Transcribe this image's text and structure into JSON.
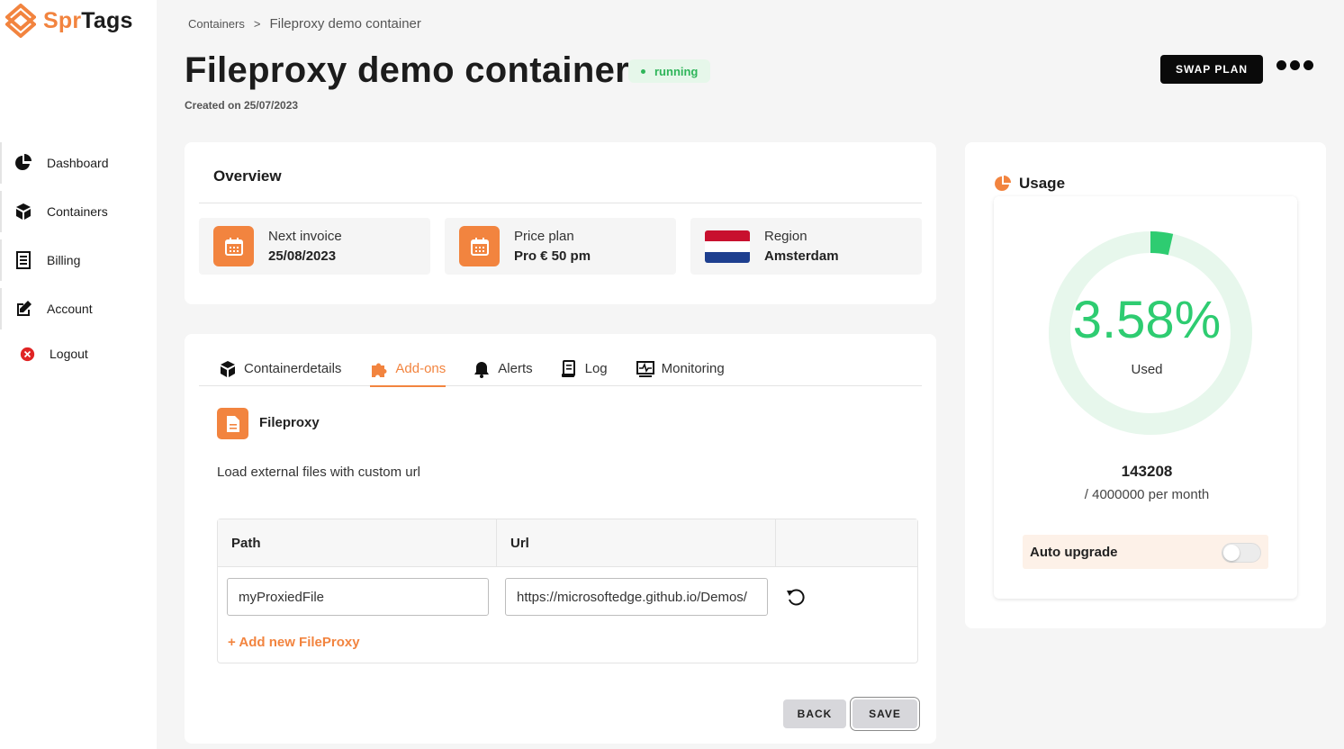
{
  "app": {
    "logo_part1": "Spr",
    "logo_part2": "Tags"
  },
  "sidebar": {
    "items": [
      {
        "label": "Dashboard",
        "icon": "pie-chart-icon"
      },
      {
        "label": "Containers",
        "icon": "box-icon"
      },
      {
        "label": "Billing",
        "icon": "receipt-icon"
      },
      {
        "label": "Account",
        "icon": "edit-icon"
      },
      {
        "label": "Logout",
        "icon": "close-circle-icon"
      }
    ]
  },
  "breadcrumb": {
    "parent": "Containers",
    "separator": ">",
    "current": "Fileproxy demo container"
  },
  "header": {
    "title": "Fileproxy demo container",
    "status": "running",
    "created": "Created on 25/07/2023",
    "swap_label": "SWAP PLAN"
  },
  "overview": {
    "title": "Overview",
    "next_invoice": {
      "label": "Next invoice",
      "value": "25/08/2023"
    },
    "price_plan": {
      "label": "Price plan",
      "value": "Pro € 50 pm"
    },
    "region": {
      "label": "Region",
      "value": "Amsterdam"
    }
  },
  "tabs": [
    {
      "label": "Containerdetails"
    },
    {
      "label": "Add-ons"
    },
    {
      "label": "Alerts"
    },
    {
      "label": "Log"
    },
    {
      "label": "Monitoring"
    }
  ],
  "addon": {
    "title": "Fileproxy",
    "description": "Load external files with custom url",
    "columns": {
      "path": "Path",
      "url": "Url"
    },
    "row": {
      "path": "myProxiedFile",
      "url": "https://microsoftedge.github.io/Demos/"
    },
    "add_label": "+ Add new FileProxy"
  },
  "actions": {
    "back": "BACK",
    "save": "SAVE"
  },
  "usage": {
    "title": "Usage",
    "percent_text": "3.58%",
    "percent_value": 3.58,
    "used_label": "Used",
    "count": "143208",
    "limit": "/ 4000000 per month",
    "auto_upgrade_label": "Auto upgrade",
    "auto_upgrade_on": false
  },
  "colors": {
    "accent": "#f2843f",
    "success": "#2ecc71",
    "gauge_track": "#e7f7ec",
    "dark": "#0a0a0a"
  }
}
